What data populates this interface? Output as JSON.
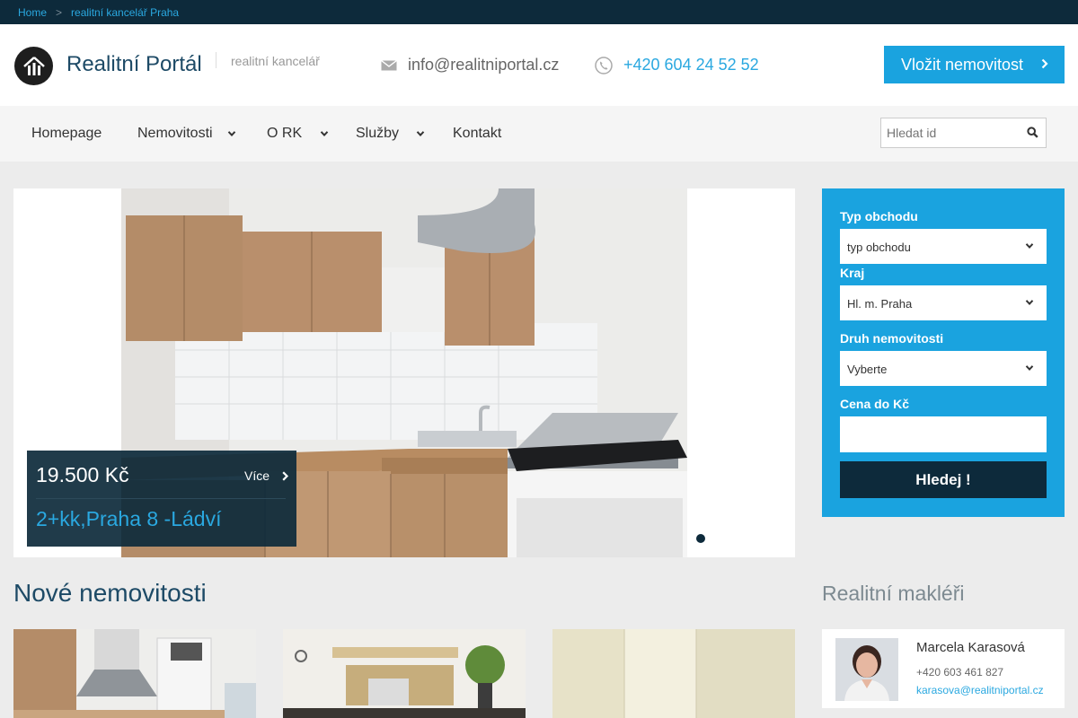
{
  "breadcrumb": {
    "home": "Home",
    "sep": ">",
    "current": "realitní kancelář Praha"
  },
  "header": {
    "title": "Realitní Portál",
    "subtitle": "realitní kancelář",
    "email": "info@realitniportal.cz",
    "phone": "+420 604 24 52 52",
    "cta_label": "Vložit nemovitost"
  },
  "nav": {
    "items": [
      {
        "label": "Homepage"
      },
      {
        "label": "Nemovitosti"
      },
      {
        "label": "O RK"
      },
      {
        "label": "Služby"
      },
      {
        "label": "Kontakt"
      }
    ],
    "search_placeholder": "Hledat id"
  },
  "slider": {
    "price": "19.500 Kč",
    "more": "Více",
    "title": "2+kk,Praha 8 -Ládví"
  },
  "filter": {
    "type_label": "Typ obchodu",
    "type_value": "typ obchodu",
    "region_label": "Kraj",
    "region_value": "Hl. m. Praha",
    "kind_label": "Druh nemovitosti",
    "kind_value": "Vyberte",
    "price_label": "Cena do Kč",
    "price_value": "",
    "submit": "Hledej !"
  },
  "new_section": {
    "title": "Nové nemovitosti"
  },
  "agents": {
    "title": "Realitní makléři",
    "items": [
      {
        "name": "Marcela Karasová",
        "phone": "+420 603 461 827",
        "email": "karasova@realitniportal.cz"
      }
    ]
  },
  "colors": {
    "accent": "#1aa3df",
    "dark": "#0d2a3b",
    "link": "#2aa8e0"
  }
}
